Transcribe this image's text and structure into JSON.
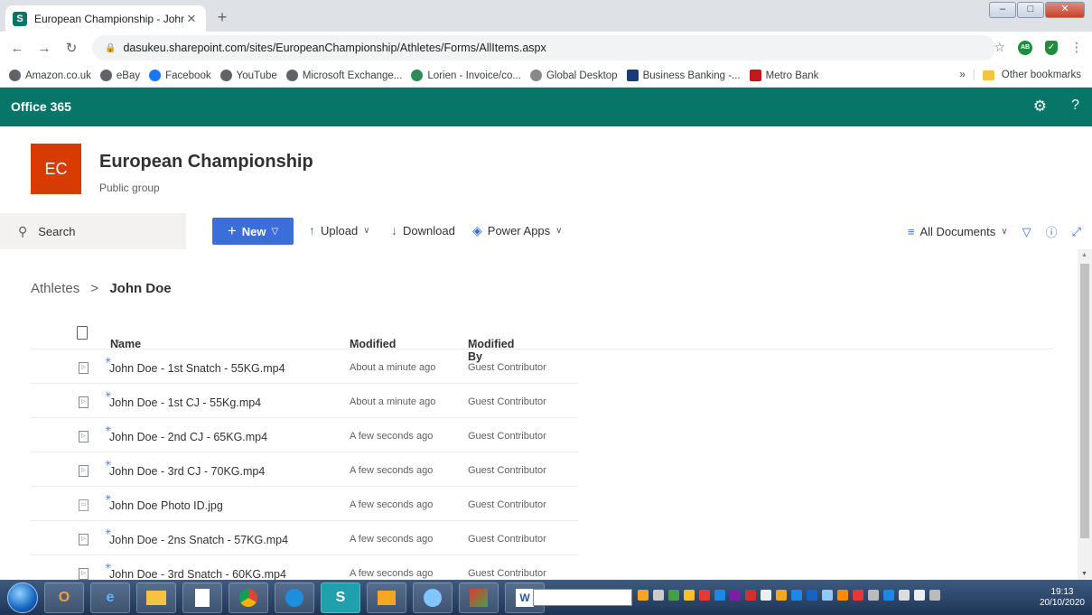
{
  "browser": {
    "tab_title": "European Championship - John D",
    "tab_close": "✕",
    "new_tab": "+",
    "url": "dasukeu.sharepoint.com/sites/EuropeanChampionship/Athletes/Forms/AllItems.aspx",
    "profile_initials": "AB",
    "bookmarks": [
      "Amazon.co.uk",
      "eBay",
      "Facebook",
      "YouTube",
      "Microsoft Exchange...",
      "Lorien - Invoice/co...",
      "Global Desktop",
      "Business Banking -...",
      "Metro Bank"
    ],
    "bookmarks_overflow": "»",
    "other_bookmarks": "Other bookmarks"
  },
  "o365": {
    "brand": "Office 365",
    "help": "?"
  },
  "site": {
    "logo_initials": "EC",
    "title": "European Championship",
    "subtitle": "Public group"
  },
  "commandbar": {
    "search": "Search",
    "new": "New",
    "upload": "Upload",
    "download": "Download",
    "power_apps": "Power Apps",
    "view": "All Documents"
  },
  "breadcrumb": {
    "parent": "Athletes",
    "separator": ">",
    "current": "John Doe"
  },
  "list": {
    "columns": {
      "name": "Name",
      "modified": "Modified",
      "modified_by": "Modified By"
    },
    "rows": [
      {
        "name": "John Doe - 1st Snatch - 55KG.mp4",
        "modified": "About a minute ago",
        "modified_by": "Guest Contributor",
        "type": "video"
      },
      {
        "name": "John Doe - 1st CJ - 55Kg.mp4",
        "modified": "About a minute ago",
        "modified_by": "Guest Contributor",
        "type": "video"
      },
      {
        "name": "John Doe - 2nd CJ - 65KG.mp4",
        "modified": "A few seconds ago",
        "modified_by": "Guest Contributor",
        "type": "video"
      },
      {
        "name": "John Doe - 3rd CJ - 70KG.mp4",
        "modified": "A few seconds ago",
        "modified_by": "Guest Contributor",
        "type": "video"
      },
      {
        "name": "John Doe Photo ID.jpg",
        "modified": "A few seconds ago",
        "modified_by": "Guest Contributor",
        "type": "image"
      },
      {
        "name": "John Doe - 2ns Snatch - 57KG.mp4",
        "modified": "A few seconds ago",
        "modified_by": "Guest Contributor",
        "type": "video"
      },
      {
        "name": "John Doe - 3rd Snatch - 60KG.mp4",
        "modified": "A few seconds ago",
        "modified_by": "Guest Contributor",
        "type": "video"
      }
    ]
  },
  "taskbar": {
    "time": "19:13",
    "date": "20/10/2020"
  },
  "colors": {
    "o365_bar": "#077568",
    "logo": "#d83b01",
    "new_button": "#3b6ed9"
  }
}
